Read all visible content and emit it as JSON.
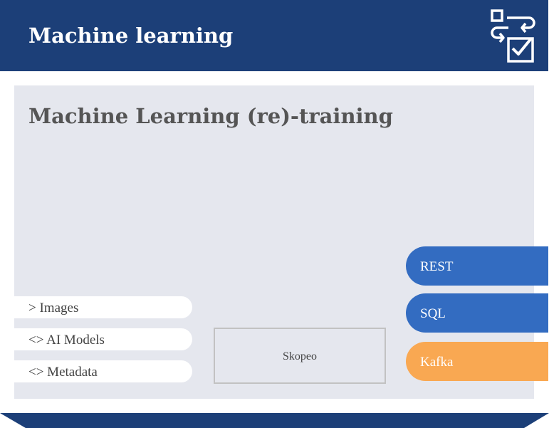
{
  "header": {
    "title": "Machine learning",
    "icon": "workflow-checklist-icon",
    "background_color": "#1c3f78"
  },
  "panel": {
    "title": "Machine Learning (re)-training",
    "background_color": "#e5e7ee"
  },
  "artifacts": [
    {
      "label": "> Images"
    },
    {
      "label": "<> AI Models"
    },
    {
      "label": "<> Metadata"
    }
  ],
  "tool": {
    "label": "Skopeo"
  },
  "interfaces": [
    {
      "label": "REST",
      "color": "#336cc1"
    },
    {
      "label": "SQL",
      "color": "#336cc1"
    },
    {
      "label": "Kafka",
      "color": "#f9a852"
    }
  ],
  "footer": {
    "color": "#1c3f78"
  }
}
